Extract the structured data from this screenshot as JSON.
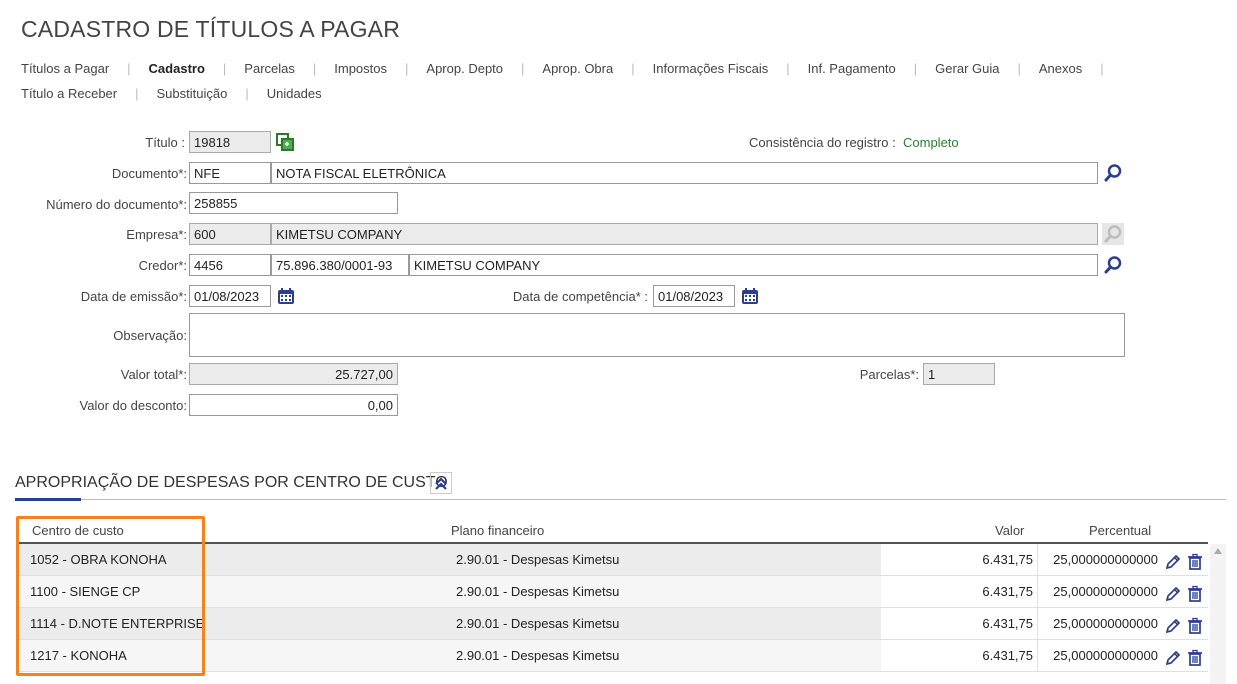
{
  "page": {
    "title": "CADASTRO DE TÍTULOS A PAGAR"
  },
  "tabs_row1": [
    "Títulos a Pagar",
    "Cadastro",
    "Parcelas",
    "Impostos",
    "Aprop. Depto",
    "Aprop. Obra",
    "Informações Fiscais",
    "Inf. Pagamento",
    "Gerar Guia",
    "Anexos"
  ],
  "tabs_row2": [
    "Título a Receber",
    "Substituição",
    "Unidades"
  ],
  "active_tab": "Cadastro",
  "form": {
    "titulo_label": "Título :",
    "titulo_value": "19818",
    "consistencia_label": "Consistência do registro :",
    "consistencia_value": "Completo",
    "documento_label": "Documento*:",
    "documento_code": "NFE",
    "documento_desc": "NOTA FISCAL ELETRÔNICA",
    "numero_label": "Número do documento*:",
    "numero_value": "258855",
    "empresa_label": "Empresa*:",
    "empresa_code": "600",
    "empresa_name": "KIMETSU COMPANY",
    "credor_label": "Credor*:",
    "credor_code": "4456",
    "credor_cnpj": "75.896.380/0001-93",
    "credor_name": "KIMETSU COMPANY",
    "emissao_label": "Data de emissão*:",
    "emissao_value": "01/08/2023",
    "competencia_label": "Data de competência* :",
    "competencia_value": "01/08/2023",
    "observacao_label": "Observação:",
    "observacao_value": "",
    "valor_total_label": "Valor total*:",
    "valor_total_value": "25.727,00",
    "parcelas_label": "Parcelas*:",
    "parcelas_value": "1",
    "desconto_label": "Valor do desconto:",
    "desconto_value": "0,00"
  },
  "section": {
    "title": "APROPRIAÇÃO DE DESPESAS POR CENTRO DE CUSTO",
    "columns": {
      "centro": "Centro de custo",
      "plano": "Plano financeiro",
      "valor": "Valor",
      "percentual": "Percentual"
    },
    "rows": [
      {
        "centro": "1052 - OBRA KONOHA",
        "plano": "2.90.01 - Despesas Kimetsu",
        "valor": "6.431,75",
        "percentual": "25,000000000000"
      },
      {
        "centro": "1100 - SIENGE CP",
        "plano": "2.90.01 - Despesas Kimetsu",
        "valor": "6.431,75",
        "percentual": "25,000000000000"
      },
      {
        "centro": "1114 - D.NOTE ENTERPRISE",
        "plano": "2.90.01 - Despesas Kimetsu",
        "valor": "6.431,75",
        "percentual": "25,000000000000"
      },
      {
        "centro": "1217 - KONOHA",
        "plano": "2.90.01 - Despesas Kimetsu",
        "valor": "6.431,75",
        "percentual": "25,000000000000"
      }
    ]
  },
  "colors": {
    "accent": "#2c3e8f",
    "highlight": "#f5821f",
    "status_ok": "#2e7d32"
  },
  "icons": [
    "copy-icon",
    "search-icon",
    "calendar-icon",
    "chevron-up-double-icon",
    "edit-icon",
    "trash-icon"
  ]
}
